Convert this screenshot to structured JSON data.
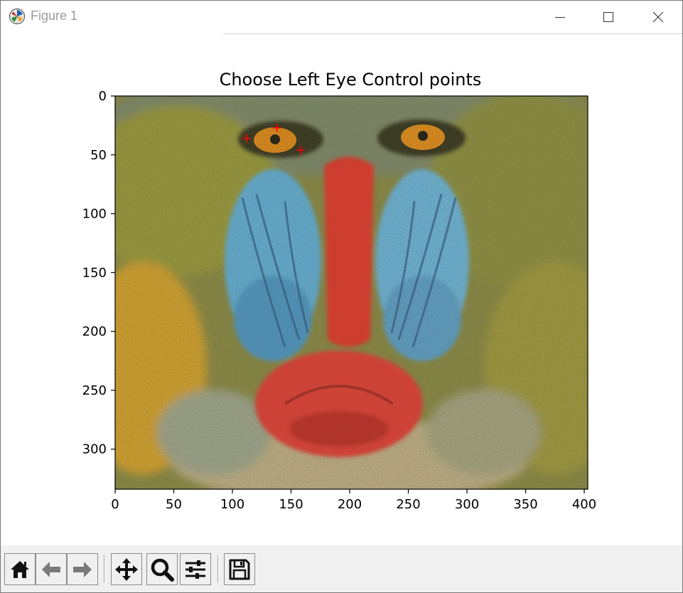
{
  "window": {
    "title": "Figure 1",
    "controls": {
      "minimize": "minimize-icon",
      "maximize": "maximize-icon",
      "close": "close-icon"
    }
  },
  "chart_data": {
    "type": "scatter",
    "title": "Choose Left Eye Control points",
    "background_image": "mandrill face photograph (imshow)",
    "xlabel": "",
    "ylabel": "",
    "xlim": [
      0,
      403
    ],
    "ylim": [
      334,
      0
    ],
    "x_ticks": [
      0,
      50,
      100,
      150,
      200,
      250,
      300,
      350,
      400
    ],
    "y_ticks": [
      0,
      50,
      100,
      150,
      200,
      250,
      300
    ],
    "points": [
      {
        "x": 112,
        "y": 36
      },
      {
        "x": 138,
        "y": 27
      },
      {
        "x": 158,
        "y": 46
      }
    ],
    "marker": "+",
    "marker_color": "#ff0000",
    "grid": false
  },
  "toolbar": {
    "buttons": [
      {
        "name": "home-button",
        "icon": "home-icon"
      },
      {
        "name": "back-button",
        "icon": "back-arrow-icon"
      },
      {
        "name": "forward-button",
        "icon": "forward-arrow-icon"
      },
      {
        "name": "pan-button",
        "icon": "move-icon"
      },
      {
        "name": "zoom-button",
        "icon": "magnifier-icon"
      },
      {
        "name": "configure-subplots-button",
        "icon": "sliders-icon"
      },
      {
        "name": "save-button",
        "icon": "floppy-disk-icon"
      }
    ]
  }
}
